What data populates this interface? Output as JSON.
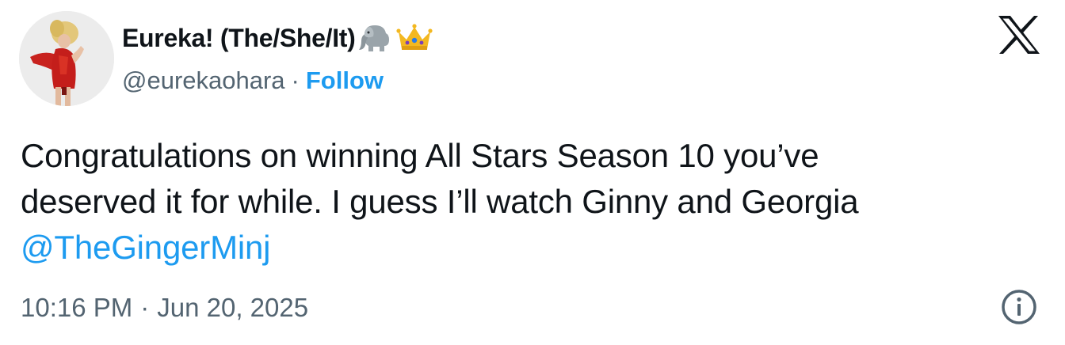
{
  "author": {
    "display_name": "Eureka! (The/She/It)",
    "badges": [
      "elephant-emoji",
      "crown-emoji"
    ],
    "handle": "@eurekaohara",
    "separator": "·",
    "follow_label": "Follow",
    "avatar": "profile-photo"
  },
  "platform_logo": "x-logo-icon",
  "tweet": {
    "lines": [
      "Congratulations on winning All Stars Season 10 you’ve",
      "deserved it for while. I guess I’ll watch Ginny and Georgia"
    ],
    "mention": "@TheGingerMinj"
  },
  "meta": {
    "time": "10:16 PM",
    "separator": "·",
    "date": "Jun 20, 2025",
    "info_icon": "info-icon"
  },
  "colors": {
    "link": "#1d9bf0",
    "text": "#0f1419",
    "secondary": "#536471"
  }
}
